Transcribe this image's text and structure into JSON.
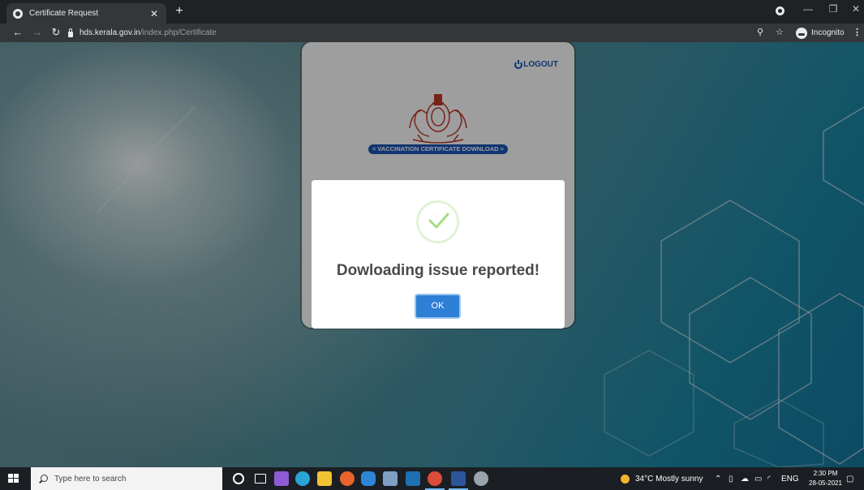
{
  "browser": {
    "tab_title": "Certificate Request",
    "url_domain": "hds.kerala.gov.in",
    "url_path": "/index.php/Certificate",
    "incognito_label": "Incognito"
  },
  "page": {
    "logout_label": "LOGOUT",
    "vaccination_label": "= VACCINATION CERTIFICATE DOWNLOAD ="
  },
  "modal": {
    "title": "Dowloading issue reported!",
    "ok_label": "OK",
    "success_color": "#a5dc86"
  },
  "taskbar": {
    "search_placeholder": "Type here to search",
    "weather": "34°C  Mostly sunny",
    "language": "ENG",
    "time": "2:30 PM",
    "date": "28-05-2021"
  },
  "colors": {
    "accent_blue": "#1a56b8",
    "ok_button": "#2e7fd6",
    "browser_dark": "#202124"
  }
}
